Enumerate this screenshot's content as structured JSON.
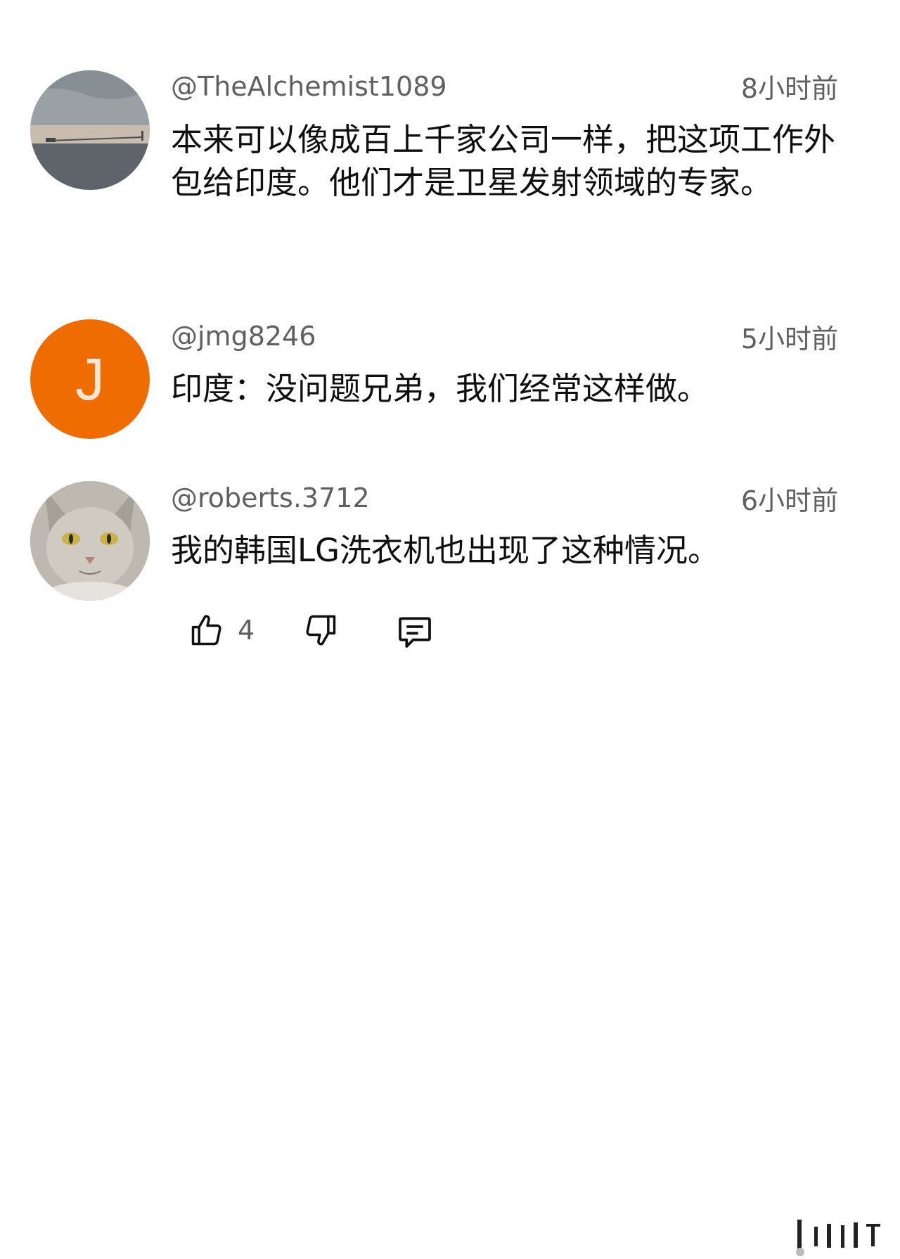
{
  "comments": [
    {
      "author": "@TheAlchemist1089",
      "time": "8小时前",
      "text": "本来可以像成百上千家公司一样，把这项工作外包给印度。他们才是卫星发射领域的专家。",
      "avatar_type": "photo-seascape"
    },
    {
      "author": "@jmg8246",
      "time": "5小时前",
      "text": "印度：没问题兄弟，我们经常这样做。",
      "avatar_letter": "J",
      "avatar_color": "#ef6c00"
    },
    {
      "author": "@roberts.3712",
      "time": "6小时前",
      "text": "我的韩国LG洗衣机也出现了这种情况。",
      "avatar_type": "photo-cat"
    }
  ],
  "actions": {
    "like_icon": "thumbs-up-icon",
    "like_count": "4",
    "dislike_icon": "thumbs-down-icon",
    "reply_icon": "comment-icon"
  },
  "colors": {
    "text_primary": "#0f0f0f",
    "text_secondary": "#606060"
  }
}
